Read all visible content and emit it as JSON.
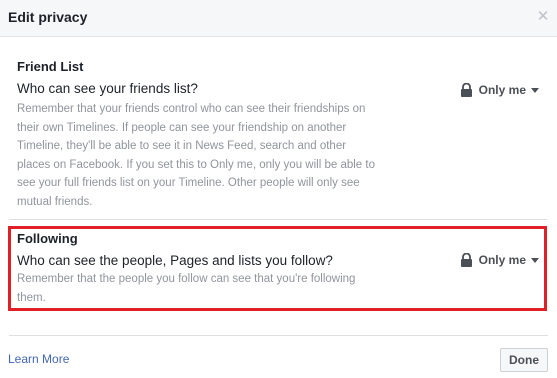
{
  "dialog": {
    "title": "Edit privacy",
    "close_glyph": "✕"
  },
  "sections": [
    {
      "title": "Friend List",
      "question": "Who can see your friends list?",
      "description": "Remember that your friends control who can see their friendships on their own Timelines. If people can see your friendship on another Timeline, they'll be able to see it in News Feed, search and other places on Facebook. If you set this to Only me, only you will be able to see your full friends list on your Timeline. Other people will only see mutual friends.",
      "audience": "Only me",
      "audience_icon": "lock-icon"
    },
    {
      "title": "Following",
      "question": "Who can see the people, Pages and lists you follow?",
      "description": "Remember that the people you follow can see that you're following them.",
      "audience": "Only me",
      "audience_icon": "lock-icon",
      "highlighted": true
    }
  ],
  "footer": {
    "learn_more": "Learn More",
    "done": "Done"
  },
  "colors": {
    "highlight": "#e01f26",
    "link": "#4267b2",
    "header_bg": "#f6f7f9"
  }
}
